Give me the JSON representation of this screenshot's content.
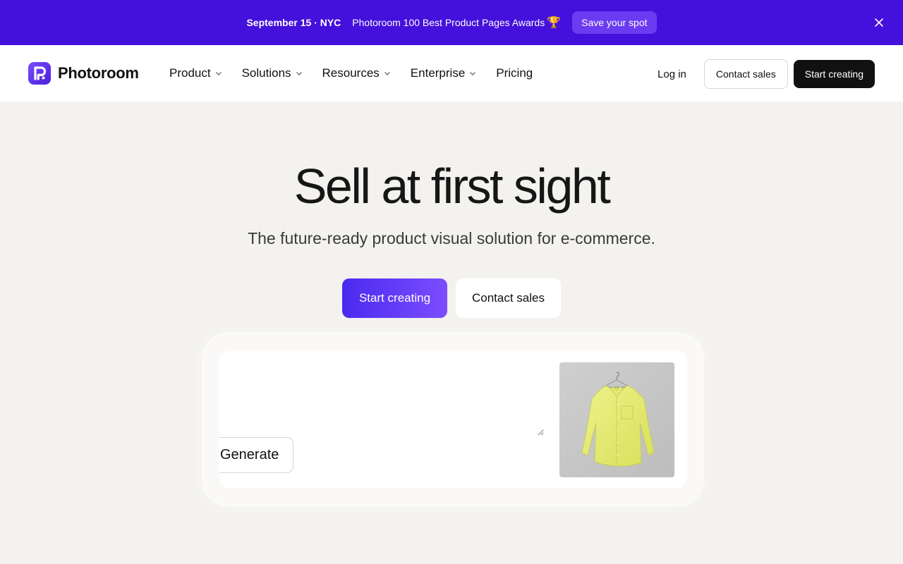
{
  "banner": {
    "date": "September 15 · NYC",
    "text": "Photoroom 100 Best Product Pages Awards",
    "trophy": "🏆",
    "cta": "Save your spot",
    "close_icon": "close-icon",
    "background": "#4410dc"
  },
  "nav": {
    "logo_text": "Photoroom",
    "logo_icon": "photoroom-logo-icon",
    "menu": [
      {
        "label": "Product",
        "has_dropdown": true
      },
      {
        "label": "Solutions",
        "has_dropdown": true
      },
      {
        "label": "Resources",
        "has_dropdown": true
      },
      {
        "label": "Enterprise",
        "has_dropdown": true
      },
      {
        "label": "Pricing",
        "has_dropdown": false
      }
    ],
    "login": "Log in",
    "contact_sales": "Contact sales",
    "start_creating": "Start creating"
  },
  "hero": {
    "title": "Sell at first sight",
    "subtitle": "The future-ready product visual solution for e-commerce.",
    "cta_primary": "Start creating",
    "cta_secondary": "Contact sales"
  },
  "demo": {
    "prompt_value": "",
    "generate_label": "Generate",
    "product_image": "yellow-shirt-on-hanger",
    "accent": "#4a2af0"
  }
}
